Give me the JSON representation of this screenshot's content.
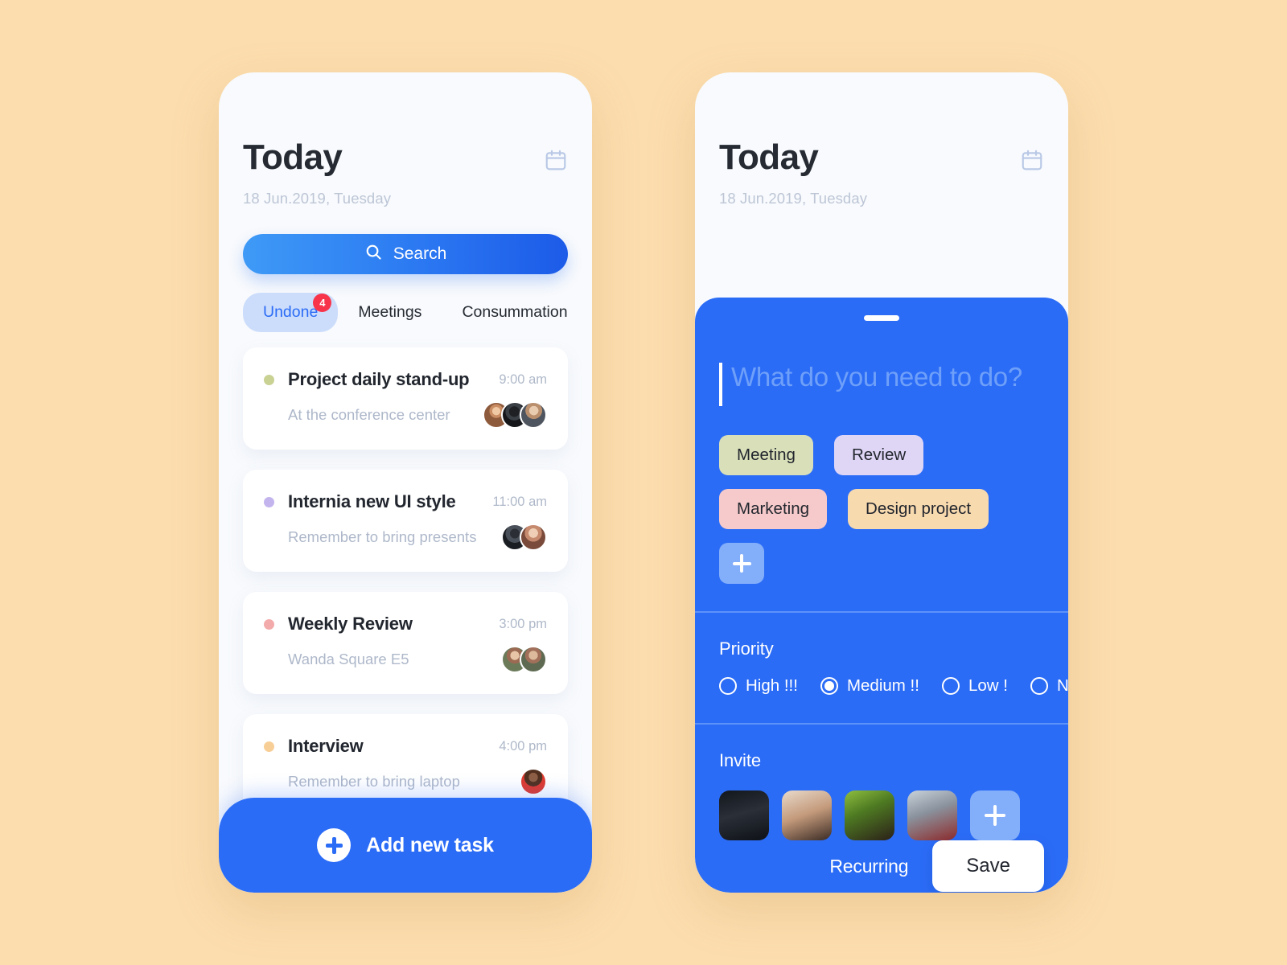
{
  "theme": {
    "background": "#FCDDAE",
    "phone_surface": "#F8FAFD",
    "accent_blue": "#2B6CF6",
    "badge_red": "#F8344B",
    "muted_text": "#AEB8CA"
  },
  "left_screen": {
    "header": {
      "title": "Today",
      "date": "18 Jun.2019, Tuesday",
      "calendar_icon": "calendar-icon"
    },
    "search": {
      "label": "Search",
      "icon": "search-icon"
    },
    "tabs": [
      {
        "label": "Undone",
        "active": true,
        "badge": "4"
      },
      {
        "label": "Meetings",
        "active": false,
        "badge": ""
      },
      {
        "label": "Consummation",
        "active": false,
        "badge": ""
      }
    ],
    "tasks": [
      {
        "title": "Project daily stand-up",
        "subtitle": "At the conference center",
        "time": "9:00 am",
        "dot_color": "#C9D193",
        "avatars": [
          "face-a",
          "face-b",
          "face-c"
        ]
      },
      {
        "title": "Internia new UI style",
        "subtitle": "Remember to bring presents",
        "time": "11:00 am",
        "dot_color": "#C3B4EE",
        "avatars": [
          "face-d",
          "face-e"
        ]
      },
      {
        "title": "Weekly Review",
        "subtitle": "Wanda Square E5",
        "time": "3:00 pm",
        "dot_color": "#F3AAAA",
        "avatars": [
          "face-f",
          "face-g"
        ]
      },
      {
        "title": "Interview",
        "subtitle": "Remember to bring laptop",
        "time": "4:00 pm",
        "dot_color": "#F7CE96",
        "avatars": [
          "face-h"
        ]
      }
    ],
    "add_task": {
      "label": "Add new task",
      "icon": "plus-icon"
    }
  },
  "right_screen": {
    "header": {
      "title": "Today",
      "date": "18 Jun.2019, Tuesday",
      "calendar_icon": "calendar-icon"
    },
    "compose": {
      "placeholder": "What do you need to do?",
      "value": "",
      "drag_handle": "drag-handle"
    },
    "tags": [
      {
        "label": "Meeting",
        "color": "#D9E0B9"
      },
      {
        "label": "Review",
        "color": "#DFD6F6"
      },
      {
        "label": "Marketing",
        "color": "#F6CACA"
      },
      {
        "label": "Design project",
        "color": "#F8DAAF"
      }
    ],
    "tag_add_icon": "plus-icon",
    "priority": {
      "label": "Priority",
      "options": [
        {
          "label": "High !!!",
          "selected": false
        },
        {
          "label": "Medium !!",
          "selected": true
        },
        {
          "label": "Low !",
          "selected": false
        },
        {
          "label": "None",
          "selected": false
        }
      ]
    },
    "invite": {
      "label": "Invite",
      "avatars": [
        "inv-1",
        "inv-2",
        "inv-3",
        "inv-4"
      ],
      "add_icon": "plus-icon"
    },
    "actions": {
      "recurring_label": "Recurring",
      "save_label": "Save"
    }
  }
}
